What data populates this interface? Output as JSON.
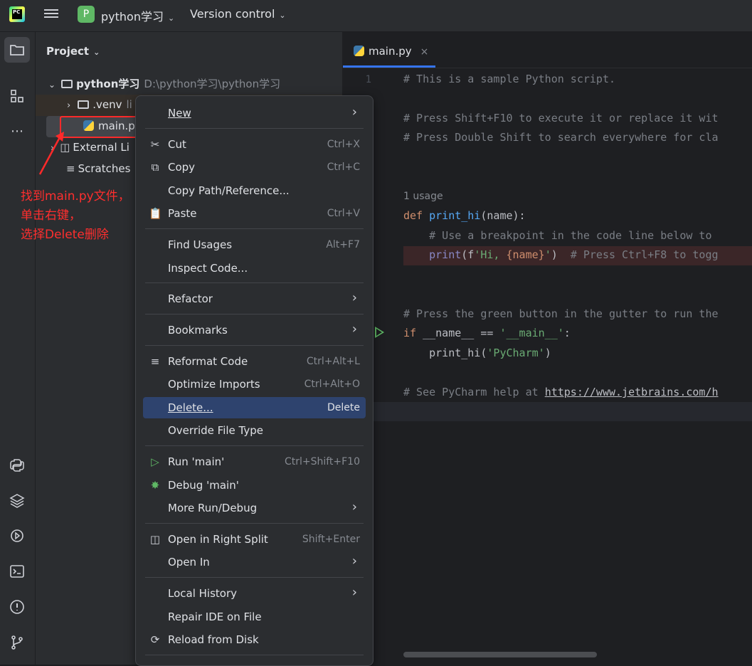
{
  "topbar": {
    "logo_text": "PC",
    "project_badge": "P",
    "project_name": "python学习",
    "vcs_label": "Version control"
  },
  "project_panel": {
    "title": "Project",
    "root_name": "python学习",
    "root_path": "D:\\python学习\\python学习",
    "venv_name": ".venv",
    "venv_suffix": "li",
    "file_name": "main.py",
    "external_label": "External Li",
    "scratches_label": "Scratches"
  },
  "annotation": {
    "line1": "找到main.py文件，",
    "line2": "单击右键，",
    "line3": "选择Delete删除",
    "color": "#ff2e2e"
  },
  "editor": {
    "tab_label": "main.py",
    "tab_close": "×",
    "line1_number": "1",
    "usage_hint": "1 usage",
    "lines": {
      "l1": "# This is a sample Python script.",
      "l3": "# Press Shift+F10 to execute it or replace it wit",
      "l4": "# Press Double Shift to search everywhere for cla",
      "l7_kw": "def ",
      "l7_fn": "print_hi",
      "l7_rest": "(name):",
      "l8": "    # Use a breakpoint in the code line below to ",
      "l9_fn": "    print",
      "l9_a": "(f",
      "l9_str1": "'Hi, ",
      "l9_var": "{name}",
      "l9_str2": "'",
      "l9_b": ")  ",
      "l9_cmt": "# Press Ctrl+F8 to togg",
      "l12": "# Press the green button in the gutter to run the",
      "l13_kw": "if ",
      "l13_a": "__name__ == ",
      "l13_str": "'__main__'",
      "l13_b": ":",
      "l14_a": "    print_hi(",
      "l14_str": "'PyCharm'",
      "l14_b": ")",
      "l16_cmt": "# See PyCharm help at ",
      "l16_link": "https://www.jetbrains.com/h"
    }
  },
  "context_menu": {
    "new": "New",
    "cut": "Cut",
    "cut_sc": "Ctrl+X",
    "copy": "Copy",
    "copy_sc": "Ctrl+C",
    "copy_path": "Copy Path/Reference...",
    "paste": "Paste",
    "paste_sc": "Ctrl+V",
    "find_usages": "Find Usages",
    "find_usages_sc": "Alt+F7",
    "inspect": "Inspect Code...",
    "refactor": "Refactor",
    "bookmarks": "Bookmarks",
    "reformat": "Reformat Code",
    "reformat_sc": "Ctrl+Alt+L",
    "optimize": "Optimize Imports",
    "optimize_sc": "Ctrl+Alt+O",
    "delete": "Delete...",
    "delete_sc": "Delete",
    "override": "Override File Type",
    "run": "Run 'main'",
    "run_sc": "Ctrl+Shift+F10",
    "debug": "Debug 'main'",
    "more_run": "More Run/Debug",
    "open_split": "Open in Right Split",
    "open_split_sc": "Shift+Enter",
    "open_in": "Open In",
    "local_history": "Local History",
    "repair": "Repair IDE on File",
    "reload": "Reload from Disk"
  },
  "colors": {
    "accent": "#3574f0",
    "selection": "#2e436e",
    "annotation_red": "#ff2a2a",
    "run_green": "#5fb865"
  }
}
